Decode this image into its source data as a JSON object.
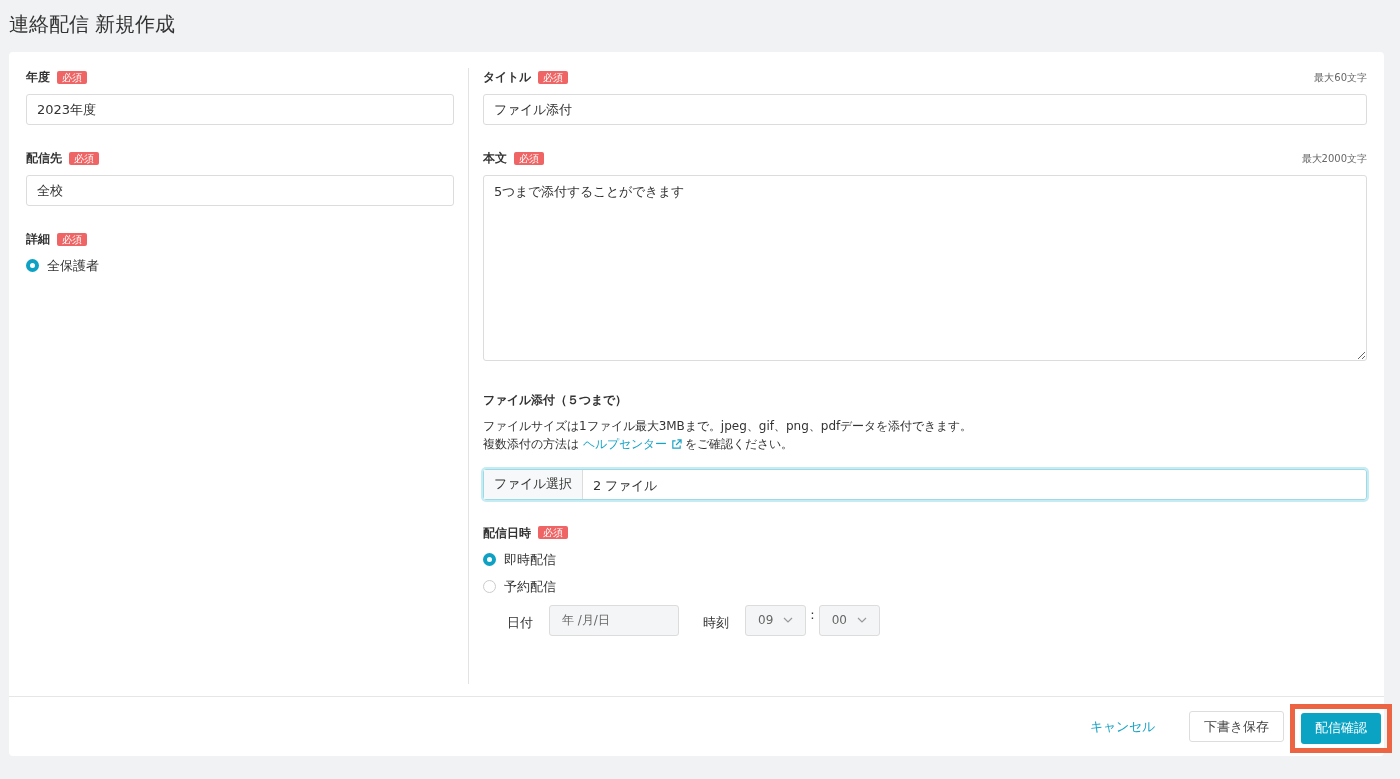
{
  "page_title": "連絡配信 新規作成",
  "left": {
    "fields": [
      {
        "kind": "text",
        "label": "年度",
        "required": true,
        "required_badge": "必須",
        "value": "2023年度"
      },
      {
        "kind": "text",
        "label": "配信先",
        "required": true,
        "required_badge": "必須",
        "value": "全校"
      },
      {
        "kind": "radio",
        "label": "詳細",
        "required": true,
        "required_badge": "必須",
        "options": [
          {
            "label": "全保護者",
            "selected": true
          }
        ]
      }
    ]
  },
  "right": {
    "title_field": {
      "label": "タイトル",
      "required": true,
      "required_badge": "必須",
      "limit": "最大60文字",
      "value": "ファイル添付"
    },
    "body_field": {
      "label": "本文",
      "required": true,
      "required_badge": "必須",
      "limit": "最大2000文字",
      "value": "5つまで添付することができます"
    },
    "attachment": {
      "label": "ファイル添付（５つまで）",
      "note_line1": "ファイルサイズは1ファイル最大3MBまで。jpeg、gif、png、pdfデータを添付できます。",
      "note_prefix": "複数添付の方法は",
      "help_link": "ヘルプセンター",
      "note_suffix": "をご確認ください。",
      "button": "ファイル選択",
      "value": "2 ファイル",
      "focused": true
    },
    "schedule": {
      "label": "配信日時",
      "required": true,
      "required_badge": "必須",
      "options": [
        {
          "label": "即時配信",
          "selected": true
        },
        {
          "label": "予約配信",
          "selected": false
        }
      ],
      "date_label": "日付",
      "date_placeholder": "年 /月/日",
      "time_label": "時刻",
      "hour": "09",
      "separator": ":",
      "minute": "00",
      "disabled": true
    }
  },
  "footer": {
    "cancel": "キャンセル",
    "save_draft": "下書き保存",
    "confirm": "配信確認",
    "confirm_highlighted": true
  }
}
